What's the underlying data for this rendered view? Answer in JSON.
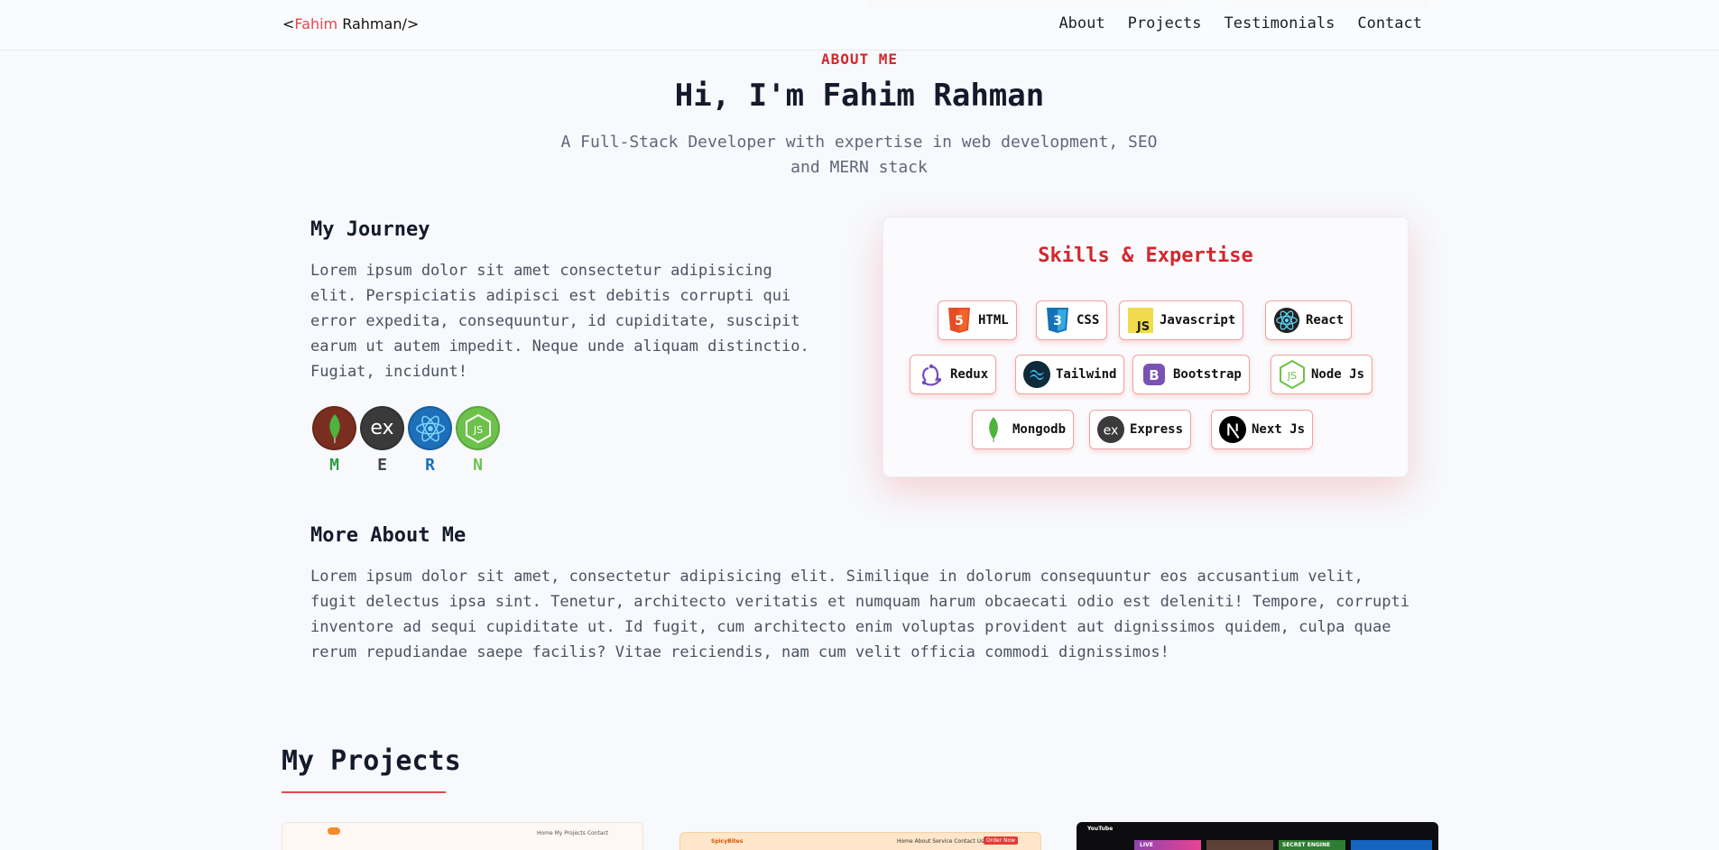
{
  "nav": {
    "logo_prefix": "<",
    "logo_first": "Fahim",
    "logo_rest": " Rahman/>",
    "links": [
      "About",
      "Projects",
      "Testimonials",
      "Contact"
    ]
  },
  "about": {
    "eyebrow": "ABOUT ME",
    "title": "Hi, I'm Fahim Rahman",
    "subtitle": "A Full-Stack Developer with expertise in web development, SEO and MERN stack"
  },
  "journey": {
    "title": "My Journey",
    "text": "Lorem ipsum dolor sit amet consectetur adipisicing elit. Perspiciatis adipisci est debitis corrupti qui error expedita, consequuntur, id cupiditate, suscipit earum ut autem impedit. Neque unde aliquam distinctio. Fugiat, incidunt!",
    "mern": [
      {
        "letter": "M",
        "icon": "mongodb-icon",
        "color": "#2f9e44"
      },
      {
        "letter": "E",
        "icon": "express-icon",
        "color": "#444444"
      },
      {
        "letter": "R",
        "icon": "react-icon",
        "color": "#1c6fb8"
      },
      {
        "letter": "N",
        "icon": "nodejs-icon",
        "color": "#6cc24a"
      }
    ]
  },
  "skills": {
    "title": "Skills & Expertise",
    "items": [
      {
        "label": "HTML",
        "icon": "html5-icon"
      },
      {
        "label": "CSS",
        "icon": "css3-icon"
      },
      {
        "label": "Javascript",
        "icon": "javascript-icon"
      },
      {
        "label": "React",
        "icon": "react-icon"
      },
      {
        "label": "Redux",
        "icon": "redux-icon"
      },
      {
        "label": "Tailwind",
        "icon": "tailwind-icon"
      },
      {
        "label": "Bootstrap",
        "icon": "bootstrap-icon"
      },
      {
        "label": "Node Js",
        "icon": "nodejs-icon"
      },
      {
        "label": "Mongodb",
        "icon": "mongodb-icon"
      },
      {
        "label": "Express",
        "icon": "express-icon"
      },
      {
        "label": "Next Js",
        "icon": "nextjs-icon"
      }
    ]
  },
  "more": {
    "title": "More About Me",
    "text": "Lorem ipsum dolor sit amet, consectetur adipisicing elit. Similique in dolorum consequuntur eos accusantium velit, fugit delectus ipsa sint. Tenetur, architecto veritatis et numquam harum obcaecati odio est deleniti! Tempore, corrupti inventore ad sequi cupiditate ut. Id fugit, cum architecto enim voluptas provident aut dignissimos quidem, culpa quae rerum repudiandae saepe facilis? Vitae reiciendis, nam cum velit officia commodi dignissimos!"
  },
  "projects": {
    "title": "My Projects",
    "cards": [
      {
        "nav": "Home   My Projects   Contact"
      },
      {
        "brand": "SpicyBites",
        "nav": "Home  About  Service  Contact Us",
        "cta": "Order Now"
      },
      {
        "brand": "YouTube",
        "banner": "SECRET ENGINE",
        "badge": "LIVE"
      }
    ]
  }
}
